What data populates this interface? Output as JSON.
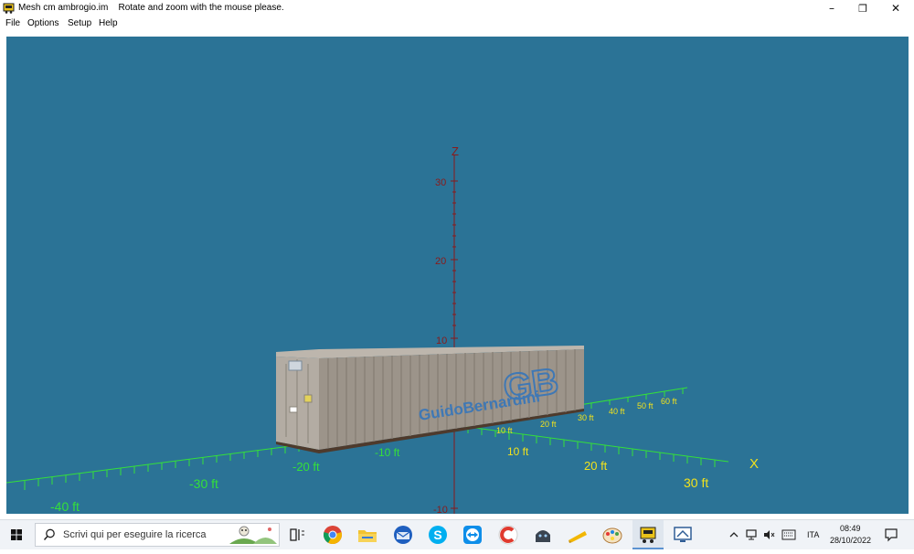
{
  "window": {
    "app_title": "Mesh cm ambrogio.im",
    "hint": "Rotate and zoom with the mouse please.",
    "minimize_glyph": "–",
    "restore_glyph": "❐",
    "close_glyph": "✕"
  },
  "menu": {
    "items": [
      {
        "label": "File"
      },
      {
        "label": "Options"
      },
      {
        "label": "Setup"
      },
      {
        "label": "Help"
      }
    ]
  },
  "scene": {
    "background": "#2b7396",
    "axes": {
      "z_label": "Z",
      "x_label": "X",
      "z_ticks": [
        "30",
        "20",
        "10",
        "-10"
      ],
      "x_front_ticks": [
        "-40 ft",
        "-30 ft",
        "-20 ft",
        "-10 ft",
        "10 ft",
        "20 ft",
        "30 ft"
      ],
      "y_back_ticks": [
        "10 ft",
        "20 ft",
        "30 ft",
        "40 ft",
        "50 ft",
        "60 ft"
      ],
      "z_color": "#8a1a1a",
      "ground_color": "#34e03a",
      "x_color": "#f2e21c"
    },
    "container": {
      "brand_text": "GuidoBernardini",
      "logo_text": "GB",
      "body_color": "#9c948a",
      "logo_color": "#3f78b5"
    }
  },
  "taskbar": {
    "search_placeholder": "Scrivi qui per eseguire la ricerca",
    "pinned": [
      {
        "name": "task-view-icon"
      },
      {
        "name": "chrome-icon"
      },
      {
        "name": "file-explorer-icon"
      },
      {
        "name": "thunderbird-icon"
      },
      {
        "name": "skype-icon"
      },
      {
        "name": "teamviewer-icon"
      },
      {
        "name": "ccleaner-icon"
      },
      {
        "name": "game-icon"
      },
      {
        "name": "notes-icon"
      },
      {
        "name": "paint-icon"
      },
      {
        "name": "mesh-app-icon"
      },
      {
        "name": "remote-desktop-icon"
      }
    ],
    "tray": {
      "language": "ITA",
      "time": "08:49",
      "date": "28/10/2022"
    }
  }
}
